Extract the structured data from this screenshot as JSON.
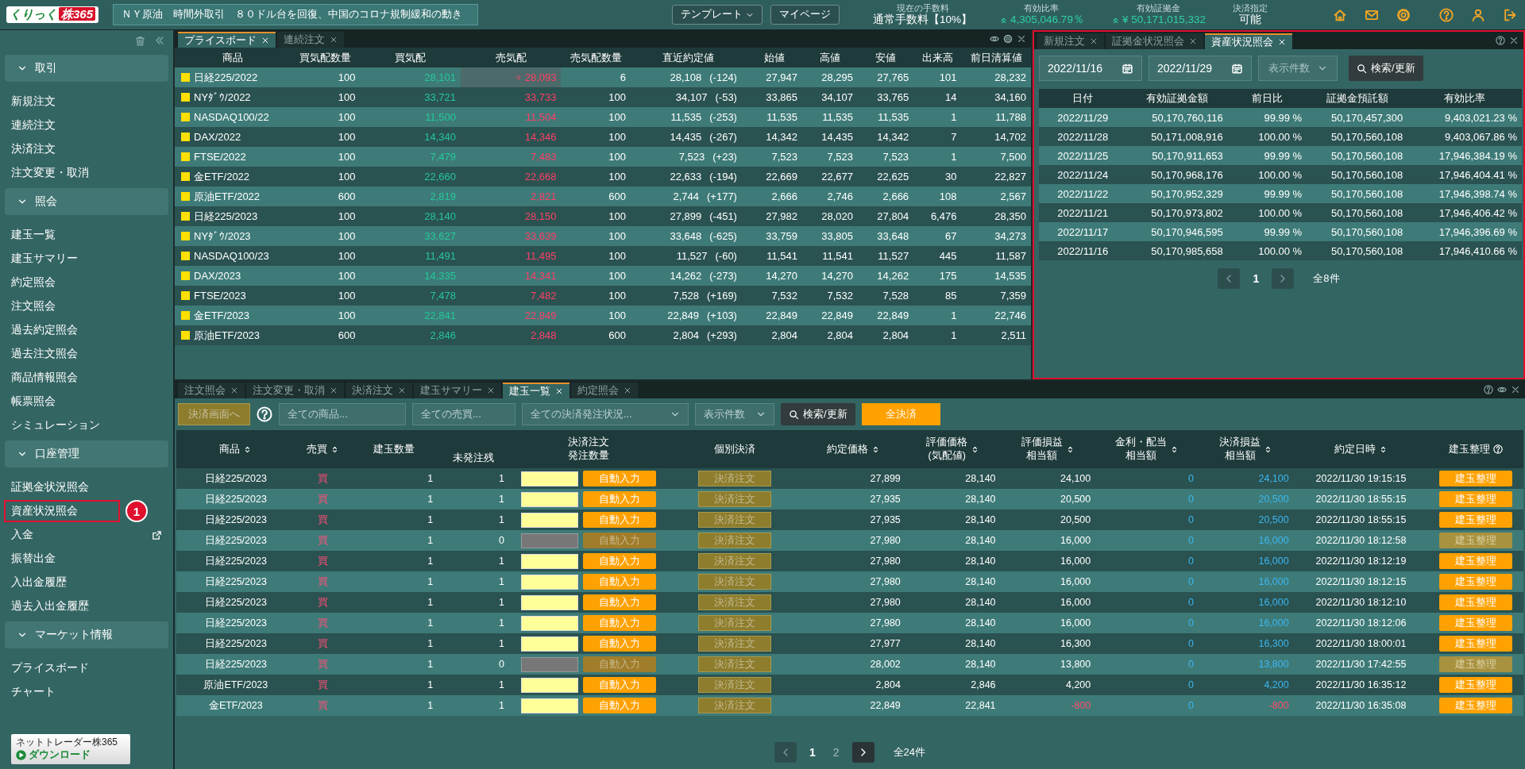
{
  "header": {
    "logo_prefix": "くりっく",
    "logo_main": "株365",
    "news": "ＮＹ原油　時間外取引　８０ドル台を回復、中国のコロナ規制緩和の動き",
    "buttons": [
      {
        "label": "テンプレート",
        "kind": "dropdown"
      },
      {
        "label": "マイページ",
        "kind": "plain"
      }
    ],
    "stats": [
      {
        "label": "現在の手数料",
        "value": "通常手数料【10%】",
        "kind": "plain"
      },
      {
        "label": "有効比率",
        "value": "4,305,046.79％",
        "kind": "indicator"
      },
      {
        "label": "有効証拠金",
        "value": "¥ 50,171,015,332",
        "kind": "indicator"
      },
      {
        "label": "決済指定",
        "value": "可能",
        "kind": "plain"
      }
    ]
  },
  "sidebar": {
    "sections": [
      {
        "title": "取引",
        "expanded": true,
        "items": [
          {
            "label": "新規注文",
            "kind": "page",
            "highlighted": false
          },
          {
            "label": "連続注文",
            "kind": "page",
            "highlighted": false
          },
          {
            "label": "決済注文",
            "kind": "page",
            "highlighted": false
          },
          {
            "label": "注文変更・取消",
            "kind": "page",
            "highlighted": false
          }
        ]
      },
      {
        "title": "照会",
        "expanded": true,
        "items": [
          {
            "label": "建玉一覧",
            "kind": "page",
            "highlighted": false
          },
          {
            "label": "建玉サマリー",
            "kind": "page",
            "highlighted": false
          },
          {
            "label": "約定照会",
            "kind": "page",
            "highlighted": false
          },
          {
            "label": "注文照会",
            "kind": "page",
            "highlighted": false
          },
          {
            "label": "過去約定照会",
            "kind": "page",
            "highlighted": false
          },
          {
            "label": "過去注文照会",
            "kind": "page",
            "highlighted": false
          },
          {
            "label": "商品情報照会",
            "kind": "page",
            "highlighted": false
          },
          {
            "label": "帳票照会",
            "kind": "page",
            "highlighted": false
          },
          {
            "label": "シミュレーション",
            "kind": "page",
            "highlighted": false
          }
        ]
      },
      {
        "title": "口座管理",
        "expanded": true,
        "items": [
          {
            "label": "証拠金状況照会",
            "kind": "page",
            "highlighted": false
          },
          {
            "label": "資産状況照会",
            "kind": "page",
            "highlighted": true,
            "badge": "1"
          },
          {
            "label": "入金",
            "kind": "external",
            "highlighted": false
          },
          {
            "label": "振替出金",
            "kind": "page",
            "highlighted": false
          },
          {
            "label": "入出金履歴",
            "kind": "page",
            "highlighted": false
          },
          {
            "label": "過去入出金履歴",
            "kind": "page",
            "highlighted": false
          }
        ]
      },
      {
        "title": "マーケット情報",
        "expanded": true,
        "items": [
          {
            "label": "プライスボード",
            "kind": "page",
            "highlighted": false
          },
          {
            "label": "チャート",
            "kind": "page",
            "highlighted": false
          }
        ]
      }
    ],
    "download": {
      "line_1": "ネットトレーダー株365",
      "line_2": "ダウンロード"
    }
  },
  "price_board": {
    "tabs": [
      {
        "label": "プライスボード",
        "selected": true
      },
      {
        "label": "連続注文",
        "selected": false
      }
    ],
    "columns": [
      "商品",
      "買気配数量",
      "買気配",
      "売気配",
      "売気配数量",
      "直近約定値",
      "始値",
      "高値",
      "安値",
      "出来高",
      "前日清算値"
    ],
    "rows": [
      {
        "name": "日経225/2022",
        "bid_qty": "100",
        "bid": "28,101",
        "ask": "28,093",
        "ask_flash": true,
        "ask_qty": "6",
        "last": "28,108",
        "change": "(-124)",
        "open": "27,947",
        "high": "28,295",
        "low": "27,765",
        "volume": "101",
        "prev": "28,232"
      },
      {
        "name": "NYﾀﾞｳ/2022",
        "bid_qty": "100",
        "bid": "33,721",
        "ask": "33,733",
        "ask_flash": false,
        "ask_qty": "100",
        "last": "34,107",
        "change": "(-53)",
        "open": "33,865",
        "high": "34,107",
        "low": "33,765",
        "volume": "14",
        "prev": "34,160"
      },
      {
        "name": "NASDAQ100/22",
        "bid_qty": "100",
        "bid": "11,500",
        "ask": "11,504",
        "ask_flash": false,
        "ask_qty": "100",
        "last": "11,535",
        "change": "(-253)",
        "open": "11,535",
        "high": "11,535",
        "low": "11,535",
        "volume": "1",
        "prev": "11,788"
      },
      {
        "name": "DAX/2022",
        "bid_qty": "100",
        "bid": "14,340",
        "ask": "14,346",
        "ask_flash": false,
        "ask_qty": "100",
        "last": "14,435",
        "change": "(-267)",
        "open": "14,342",
        "high": "14,435",
        "low": "14,342",
        "volume": "7",
        "prev": "14,702"
      },
      {
        "name": "FTSE/2022",
        "bid_qty": "100",
        "bid": "7,479",
        "ask": "7,483",
        "ask_flash": false,
        "ask_qty": "100",
        "last": "7,523",
        "change": "(+23)",
        "open": "7,523",
        "high": "7,523",
        "low": "7,523",
        "volume": "1",
        "prev": "7,500"
      },
      {
        "name": "金ETF/2022",
        "bid_qty": "100",
        "bid": "22,660",
        "ask": "22,668",
        "ask_flash": false,
        "ask_qty": "100",
        "last": "22,633",
        "change": "(-194)",
        "open": "22,669",
        "high": "22,677",
        "low": "22,625",
        "volume": "30",
        "prev": "22,827"
      },
      {
        "name": "原油ETF/2022",
        "bid_qty": "600",
        "bid": "2,819",
        "ask": "2,821",
        "ask_flash": false,
        "ask_qty": "600",
        "last": "2,744",
        "change": "(+177)",
        "open": "2,666",
        "high": "2,746",
        "low": "2,666",
        "volume": "108",
        "prev": "2,567"
      },
      {
        "name": "日経225/2023",
        "bid_qty": "100",
        "bid": "28,140",
        "ask": "28,150",
        "ask_flash": false,
        "ask_qty": "100",
        "last": "27,899",
        "change": "(-451)",
        "open": "27,982",
        "high": "28,020",
        "low": "27,804",
        "volume": "6,476",
        "prev": "28,350"
      },
      {
        "name": "NYﾀﾞｳ/2023",
        "bid_qty": "100",
        "bid": "33,627",
        "ask": "33,639",
        "ask_flash": false,
        "ask_qty": "100",
        "last": "33,648",
        "change": "(-625)",
        "open": "33,759",
        "high": "33,805",
        "low": "33,648",
        "volume": "67",
        "prev": "34,273"
      },
      {
        "name": "NASDAQ100/23",
        "bid_qty": "100",
        "bid": "11,491",
        "ask": "11,495",
        "ask_flash": false,
        "ask_qty": "100",
        "last": "11,527",
        "change": "(-60)",
        "open": "11,541",
        "high": "11,541",
        "low": "11,527",
        "volume": "445",
        "prev": "11,587"
      },
      {
        "name": "DAX/2023",
        "bid_qty": "100",
        "bid": "14,335",
        "ask": "14,341",
        "ask_flash": false,
        "ask_qty": "100",
        "last": "14,262",
        "change": "(-273)",
        "open": "14,270",
        "high": "14,270",
        "low": "14,262",
        "volume": "175",
        "prev": "14,535"
      },
      {
        "name": "FTSE/2023",
        "bid_qty": "100",
        "bid": "7,478",
        "ask": "7,482",
        "ask_flash": false,
        "ask_qty": "100",
        "last": "7,528",
        "change": "(+169)",
        "open": "7,532",
        "high": "7,532",
        "low": "7,528",
        "volume": "85",
        "prev": "7,359"
      },
      {
        "name": "金ETF/2023",
        "bid_qty": "100",
        "bid": "22,841",
        "ask": "22,849",
        "ask_flash": false,
        "ask_qty": "100",
        "last": "22,849",
        "change": "(+103)",
        "open": "22,849",
        "high": "22,849",
        "low": "22,849",
        "volume": "1",
        "prev": "22,746"
      },
      {
        "name": "原油ETF/2023",
        "bid_qty": "600",
        "bid": "2,846",
        "ask": "2,848",
        "ask_flash": false,
        "ask_qty": "600",
        "last": "2,804",
        "change": "(+293)",
        "open": "2,804",
        "high": "2,804",
        "low": "2,804",
        "volume": "1",
        "prev": "2,511"
      }
    ]
  },
  "asset_panel": {
    "highlighted": true,
    "tabs": [
      {
        "label": "新規注文",
        "selected": false
      },
      {
        "label": "証拠金状況照会",
        "selected": false
      },
      {
        "label": "資産状況照会",
        "selected": true
      }
    ],
    "date_from": "2022/11/16",
    "date_to": "2022/11/29",
    "count_select": "表示件数",
    "search_button": "検索/更新",
    "columns": [
      "日付",
      "有効証拠金額",
      "前日比",
      "証拠金預託額",
      "有効比率"
    ],
    "rows": [
      [
        "2022/11/29",
        "50,170,760,116",
        "99.99 %",
        "50,170,457,300",
        "9,403,021.23 %"
      ],
      [
        "2022/11/28",
        "50,171,008,916",
        "100.00 %",
        "50,170,560,108",
        "9,403,067.86 %"
      ],
      [
        "2022/11/25",
        "50,170,911,653",
        "99.99 %",
        "50,170,560,108",
        "17,946,384.19 %"
      ],
      [
        "2022/11/24",
        "50,170,968,176",
        "100.00 %",
        "50,170,560,108",
        "17,946,404.41 %"
      ],
      [
        "2022/11/22",
        "50,170,952,329",
        "99.99 %",
        "50,170,560,108",
        "17,946,398.74 %"
      ],
      [
        "2022/11/21",
        "50,170,973,802",
        "100.00 %",
        "50,170,560,108",
        "17,946,406.42 %"
      ],
      [
        "2022/11/17",
        "50,170,946,595",
        "99.99 %",
        "50,170,560,108",
        "17,946,396.69 %"
      ],
      [
        "2022/11/16",
        "50,170,985,658",
        "100.00 %",
        "50,170,560,108",
        "17,946,410.66 %"
      ]
    ],
    "pagination": {
      "pages": [
        {
          "label": "1",
          "selected": true
        }
      ],
      "total": "全8件"
    }
  },
  "positions": {
    "tabs": [
      {
        "label": "注文照会",
        "selected": false
      },
      {
        "label": "注文変更・取消",
        "selected": false
      },
      {
        "label": "決済注文",
        "selected": false
      },
      {
        "label": "建玉サマリー",
        "selected": false
      },
      {
        "label": "建玉一覧",
        "selected": true
      },
      {
        "label": "約定照会",
        "selected": false
      }
    ],
    "toolbar": {
      "settle_screen_button": "決済画面へ",
      "filters": [
        {
          "label": "全ての商品...",
          "kind": "field"
        },
        {
          "label": "全ての売買...",
          "kind": "field"
        },
        {
          "label": "全ての決済発注状況...",
          "kind": "select"
        },
        {
          "label": "表示件数",
          "kind": "select"
        }
      ],
      "search_button": "検索/更新",
      "settle_all_button": "全決済"
    },
    "columns": [
      {
        "lines": [
          "商品"
        ],
        "kind": "sort"
      },
      {
        "lines": [
          "売買"
        ],
        "kind": "sort"
      },
      {
        "lines": [
          "建玉数量"
        ],
        "kind": "plain"
      },
      {
        "lines": [
          "未発注残"
        ],
        "kind": "low"
      },
      {
        "lines": [
          "決済注文",
          "発注数量"
        ],
        "kind": "plain"
      },
      {
        "lines": [
          "個別決済"
        ],
        "kind": "plain"
      },
      {
        "lines": [
          "約定価格"
        ],
        "kind": "sort"
      },
      {
        "lines": [
          "評価価格",
          "(気配値)"
        ],
        "kind": "sort"
      },
      {
        "lines": [
          "評価損益",
          "相当額"
        ],
        "kind": "sort"
      },
      {
        "lines": [
          "金利・配当",
          "相当額"
        ],
        "kind": "sort"
      },
      {
        "lines": [
          "決済損益",
          "相当額"
        ],
        "kind": "sort"
      },
      {
        "lines": [
          "約定日時"
        ],
        "kind": "sort"
      },
      {
        "lines": [
          "建玉整理"
        ],
        "kind": "help"
      }
    ],
    "rows": [
      {
        "product": "日経225/2023",
        "side": "買",
        "qty": "1",
        "remaining": "1",
        "disabled": false,
        "auto_button": "自動入力",
        "settle_button": "決済注文",
        "price": "27,899",
        "eval_price": "28,140",
        "eval_pl": "24,100",
        "interest": "0",
        "settle_pl": "24,100",
        "negative": false,
        "time": "2022/11/30 19:15:15",
        "tidy_button": "建玉整理"
      },
      {
        "product": "日経225/2023",
        "side": "買",
        "qty": "1",
        "remaining": "1",
        "disabled": false,
        "auto_button": "自動入力",
        "settle_button": "決済注文",
        "price": "27,935",
        "eval_price": "28,140",
        "eval_pl": "20,500",
        "interest": "0",
        "settle_pl": "20,500",
        "negative": false,
        "time": "2022/11/30 18:55:15",
        "tidy_button": "建玉整理"
      },
      {
        "product": "日経225/2023",
        "side": "買",
        "qty": "1",
        "remaining": "1",
        "disabled": false,
        "auto_button": "自動入力",
        "settle_button": "決済注文",
        "price": "27,935",
        "eval_price": "28,140",
        "eval_pl": "20,500",
        "interest": "0",
        "settle_pl": "20,500",
        "negative": false,
        "time": "2022/11/30 18:55:15",
        "tidy_button": "建玉整理"
      },
      {
        "product": "日経225/2023",
        "side": "買",
        "qty": "1",
        "remaining": "0",
        "disabled": true,
        "auto_button": "自動入力",
        "settle_button": "決済注文",
        "price": "27,980",
        "eval_price": "28,140",
        "eval_pl": "16,000",
        "interest": "0",
        "settle_pl": "16,000",
        "negative": false,
        "time": "2022/11/30 18:12:58",
        "tidy_button": "建玉整理"
      },
      {
        "product": "日経225/2023",
        "side": "買",
        "qty": "1",
        "remaining": "1",
        "disabled": false,
        "auto_button": "自動入力",
        "settle_button": "決済注文",
        "price": "27,980",
        "eval_price": "28,140",
        "eval_pl": "16,000",
        "interest": "0",
        "settle_pl": "16,000",
        "negative": false,
        "time": "2022/11/30 18:12:19",
        "tidy_button": "建玉整理"
      },
      {
        "product": "日経225/2023",
        "side": "買",
        "qty": "1",
        "remaining": "1",
        "disabled": false,
        "auto_button": "自動入力",
        "settle_button": "決済注文",
        "price": "27,980",
        "eval_price": "28,140",
        "eval_pl": "16,000",
        "interest": "0",
        "settle_pl": "16,000",
        "negative": false,
        "time": "2022/11/30 18:12:15",
        "tidy_button": "建玉整理"
      },
      {
        "product": "日経225/2023",
        "side": "買",
        "qty": "1",
        "remaining": "1",
        "disabled": false,
        "auto_button": "自動入力",
        "settle_button": "決済注文",
        "price": "27,980",
        "eval_price": "28,140",
        "eval_pl": "16,000",
        "interest": "0",
        "settle_pl": "16,000",
        "negative": false,
        "time": "2022/11/30 18:12:10",
        "tidy_button": "建玉整理"
      },
      {
        "product": "日経225/2023",
        "side": "買",
        "qty": "1",
        "remaining": "1",
        "disabled": false,
        "auto_button": "自動入力",
        "settle_button": "決済注文",
        "price": "27,980",
        "eval_price": "28,140",
        "eval_pl": "16,000",
        "interest": "0",
        "settle_pl": "16,000",
        "negative": false,
        "time": "2022/11/30 18:12:06",
        "tidy_button": "建玉整理"
      },
      {
        "product": "日経225/2023",
        "side": "買",
        "qty": "1",
        "remaining": "1",
        "disabled": false,
        "auto_button": "自動入力",
        "settle_button": "決済注文",
        "price": "27,977",
        "eval_price": "28,140",
        "eval_pl": "16,300",
        "interest": "0",
        "settle_pl": "16,300",
        "negative": false,
        "time": "2022/11/30 18:00:01",
        "tidy_button": "建玉整理"
      },
      {
        "product": "日経225/2023",
        "side": "買",
        "qty": "1",
        "remaining": "0",
        "disabled": true,
        "auto_button": "自動入力",
        "settle_button": "決済注文",
        "price": "28,002",
        "eval_price": "28,140",
        "eval_pl": "13,800",
        "interest": "0",
        "settle_pl": "13,800",
        "negative": false,
        "time": "2022/11/30 17:42:55",
        "tidy_button": "建玉整理"
      },
      {
        "product": "原油ETF/2023",
        "side": "買",
        "qty": "1",
        "remaining": "1",
        "disabled": false,
        "auto_button": "自動入力",
        "settle_button": "決済注文",
        "price": "2,804",
        "eval_price": "2,846",
        "eval_pl": "4,200",
        "interest": "0",
        "settle_pl": "4,200",
        "negative": false,
        "time": "2022/11/30 16:35:12",
        "tidy_button": "建玉整理"
      },
      {
        "product": "金ETF/2023",
        "side": "買",
        "qty": "1",
        "remaining": "1",
        "disabled": false,
        "auto_button": "自動入力",
        "settle_button": "決済注文",
        "price": "22,849",
        "eval_price": "22,841",
        "eval_pl": "-800",
        "interest": "0",
        "settle_pl": "-800",
        "negative": true,
        "time": "2022/11/30 16:35:08",
        "tidy_button": "建玉整理"
      }
    ],
    "pagination": {
      "pages": [
        {
          "label": "1",
          "selected": true
        },
        {
          "label": "2",
          "selected": false
        }
      ],
      "total": "全24件"
    }
  }
}
